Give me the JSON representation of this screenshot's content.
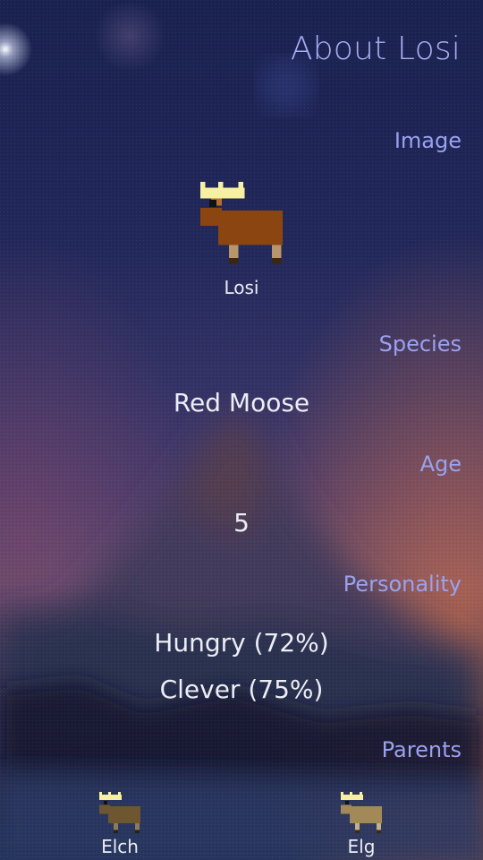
{
  "page": {
    "title": "About Losi"
  },
  "image_section": {
    "header": "Image",
    "animal_name": "Losi",
    "sprite_icon": "moose-icon",
    "body_color": "#8a4510"
  },
  "species_section": {
    "header": "Species",
    "value": "Red Moose"
  },
  "age_section": {
    "header": "Age",
    "value": "5"
  },
  "personality_section": {
    "header": "Personality",
    "traits": [
      "Hungry (72%)",
      "Clever (75%)"
    ]
  },
  "parents_section": {
    "header": "Parents",
    "parents": [
      {
        "name": "Elch",
        "sprite_icon": "moose-icon",
        "body_color": "#6e5630"
      },
      {
        "name": "Elg",
        "sprite_icon": "moose-icon",
        "body_color": "#a38858"
      }
    ]
  },
  "colors": {
    "accent": "#9aa2ef",
    "text": "#ecedf5",
    "crown": "#f6f0a0"
  }
}
